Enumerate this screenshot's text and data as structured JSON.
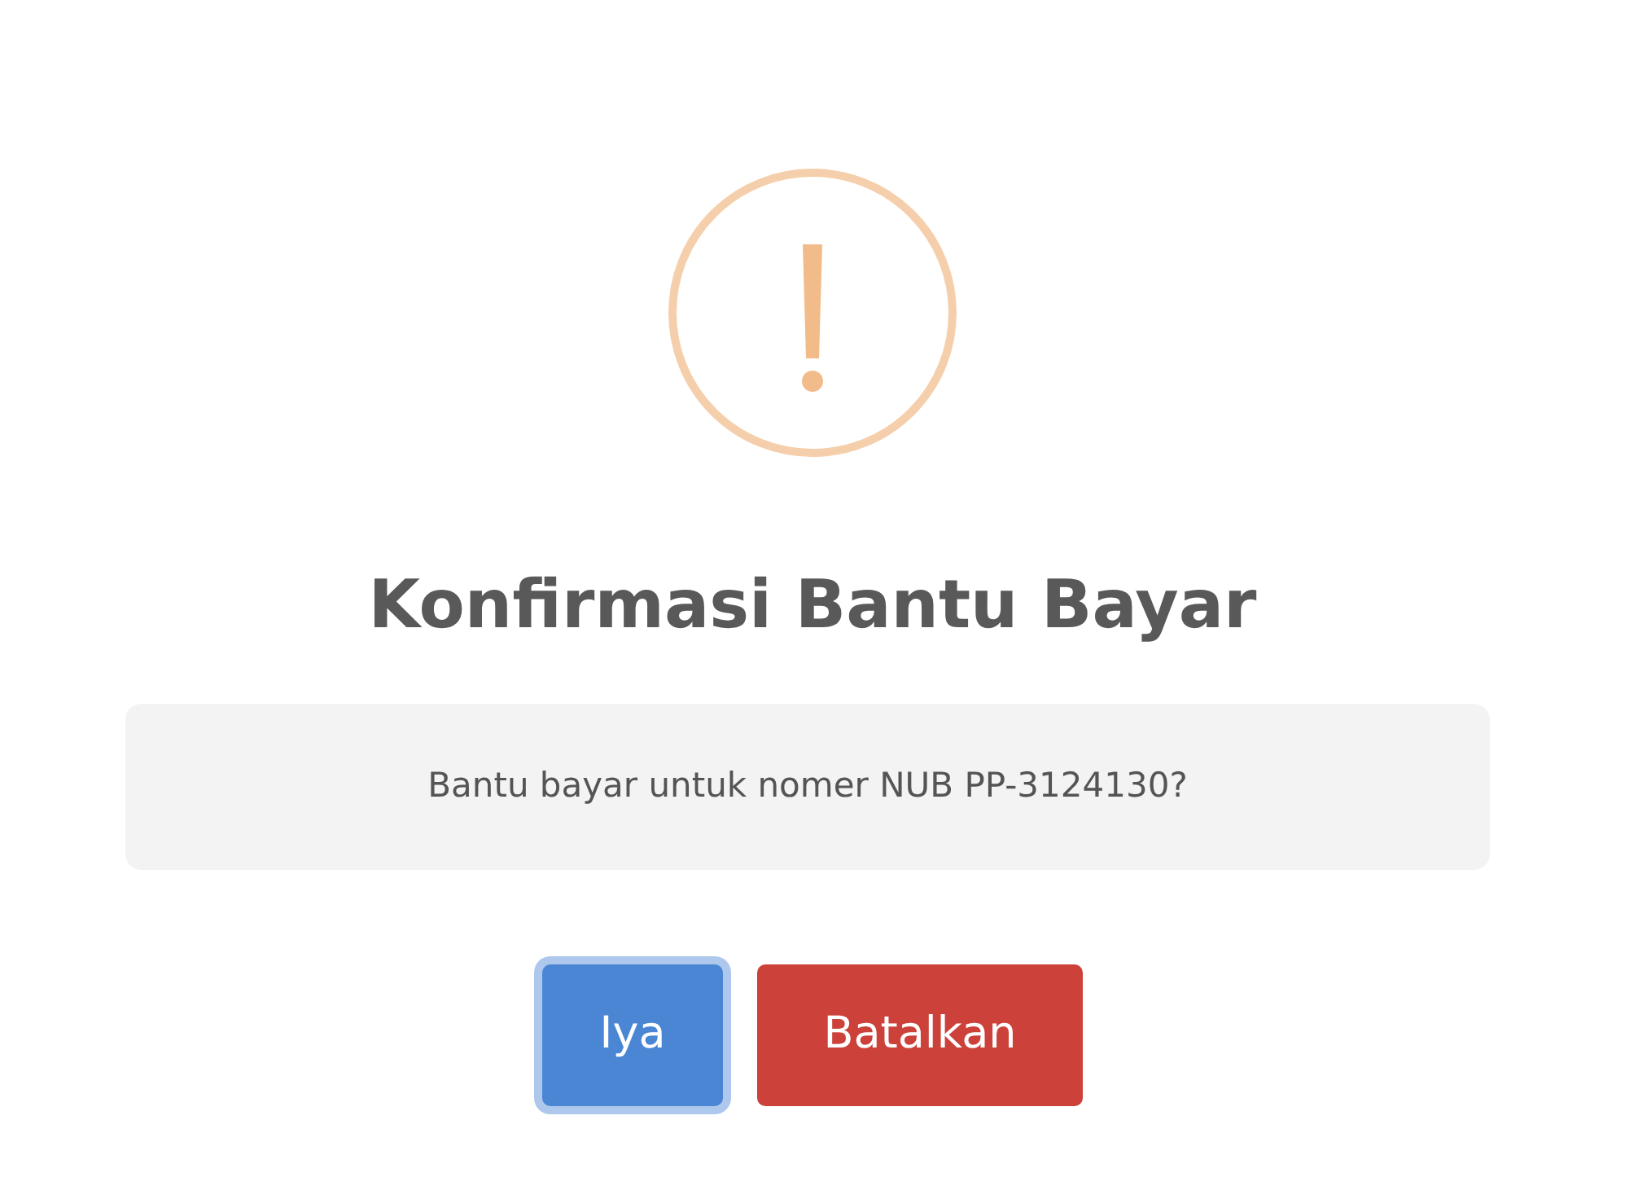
{
  "dialog": {
    "icon": {
      "kind": "warning"
    },
    "title": "Konfirmasi Bantu Bayar",
    "message": "Bantu bayar untuk nomer NUB PP-3124130?",
    "buttons": [
      {
        "label": "Iya",
        "kind": "confirm",
        "focused": true
      },
      {
        "label": "Batalkan",
        "kind": "cancel",
        "focused": false
      }
    ]
  }
}
